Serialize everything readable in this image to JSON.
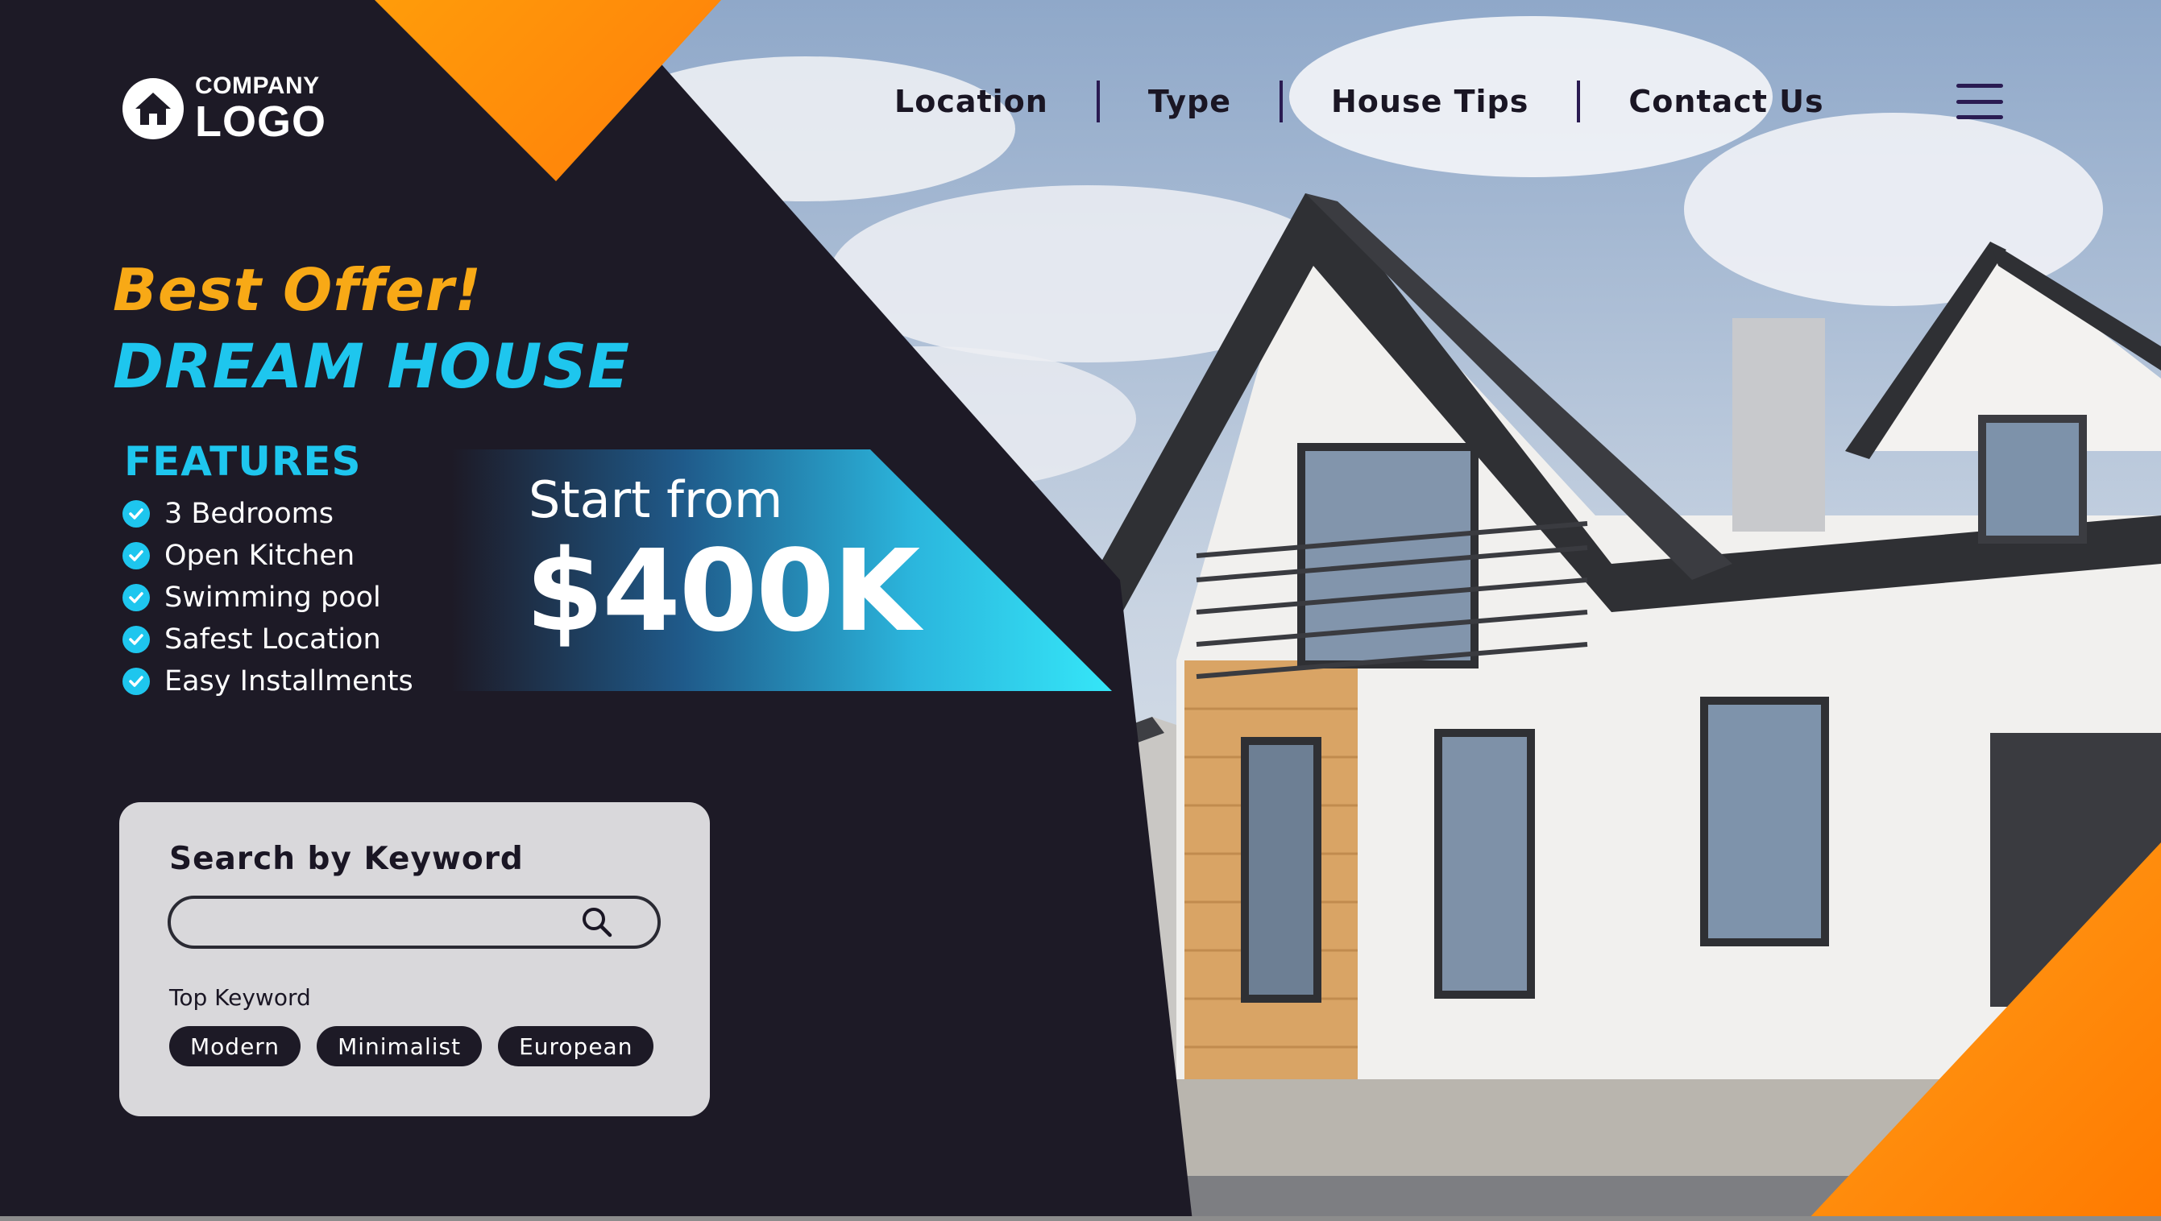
{
  "header": {
    "logo": {
      "line1": "COMPANY",
      "line2": "LOGO",
      "icon": "house-icon"
    },
    "nav": [
      {
        "label": "Location"
      },
      {
        "label": "Type"
      },
      {
        "label": "House Tips"
      },
      {
        "label": "Contact Us"
      }
    ],
    "menu_icon": "hamburger-menu-icon"
  },
  "hero": {
    "headline_1": "Best Offer!",
    "headline_2": "DREAM HOUSE",
    "features_title": "FEATURES",
    "features": [
      "3 Bedrooms",
      "Open Kitchen",
      "Swimming pool",
      "Safest Location",
      "Easy Installments"
    ],
    "price_prefix": "Start from",
    "price": "$400K"
  },
  "search": {
    "title": "Search by Keyword",
    "input_value": "",
    "input_placeholder": "",
    "icon": "search-icon",
    "top_keyword_label": "Top Keyword",
    "keywords": [
      "Modern",
      "Minimalist",
      "European"
    ]
  },
  "colors": {
    "dark_bg": "#1d1a26",
    "accent_orange": "#f8a916",
    "accent_cyan": "#1ec6ee",
    "nav_text": "#1a1624",
    "card_bg": "#d9d8db"
  }
}
